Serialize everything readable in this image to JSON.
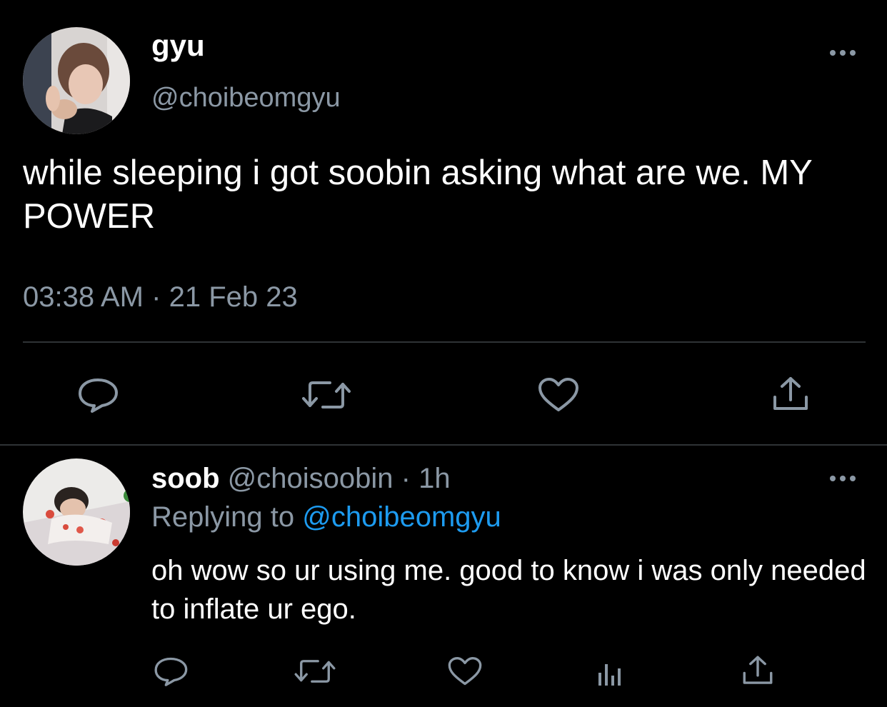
{
  "tweet": {
    "author_name": "gyu",
    "author_handle": "@choibeomgyu",
    "text": "while sleeping i got soobin asking what are we. MY POWER",
    "time": "03:38 AM",
    "separator": "·",
    "date": "21 Feb 23"
  },
  "reply": {
    "author_name": "soob",
    "author_handle": "@choisoobin",
    "separator": "·",
    "age": "1h",
    "replying_prefix": "Replying to",
    "replying_to": "@choibeomgyu",
    "text": "oh wow so ur using me. good to know i was only needed to inflate ur ego."
  },
  "icons": {
    "main_actions": [
      "reply-icon",
      "retweet-icon",
      "like-icon",
      "share-icon"
    ],
    "reply_actions": [
      "reply-icon",
      "retweet-icon",
      "like-icon",
      "analytics-icon",
      "share-icon"
    ],
    "more": "more-icon"
  },
  "colors": {
    "background": "#000000",
    "text": "#ffffff",
    "secondary": "#8b98a5",
    "link": "#1d9bf0",
    "divider": "#2f3336"
  }
}
